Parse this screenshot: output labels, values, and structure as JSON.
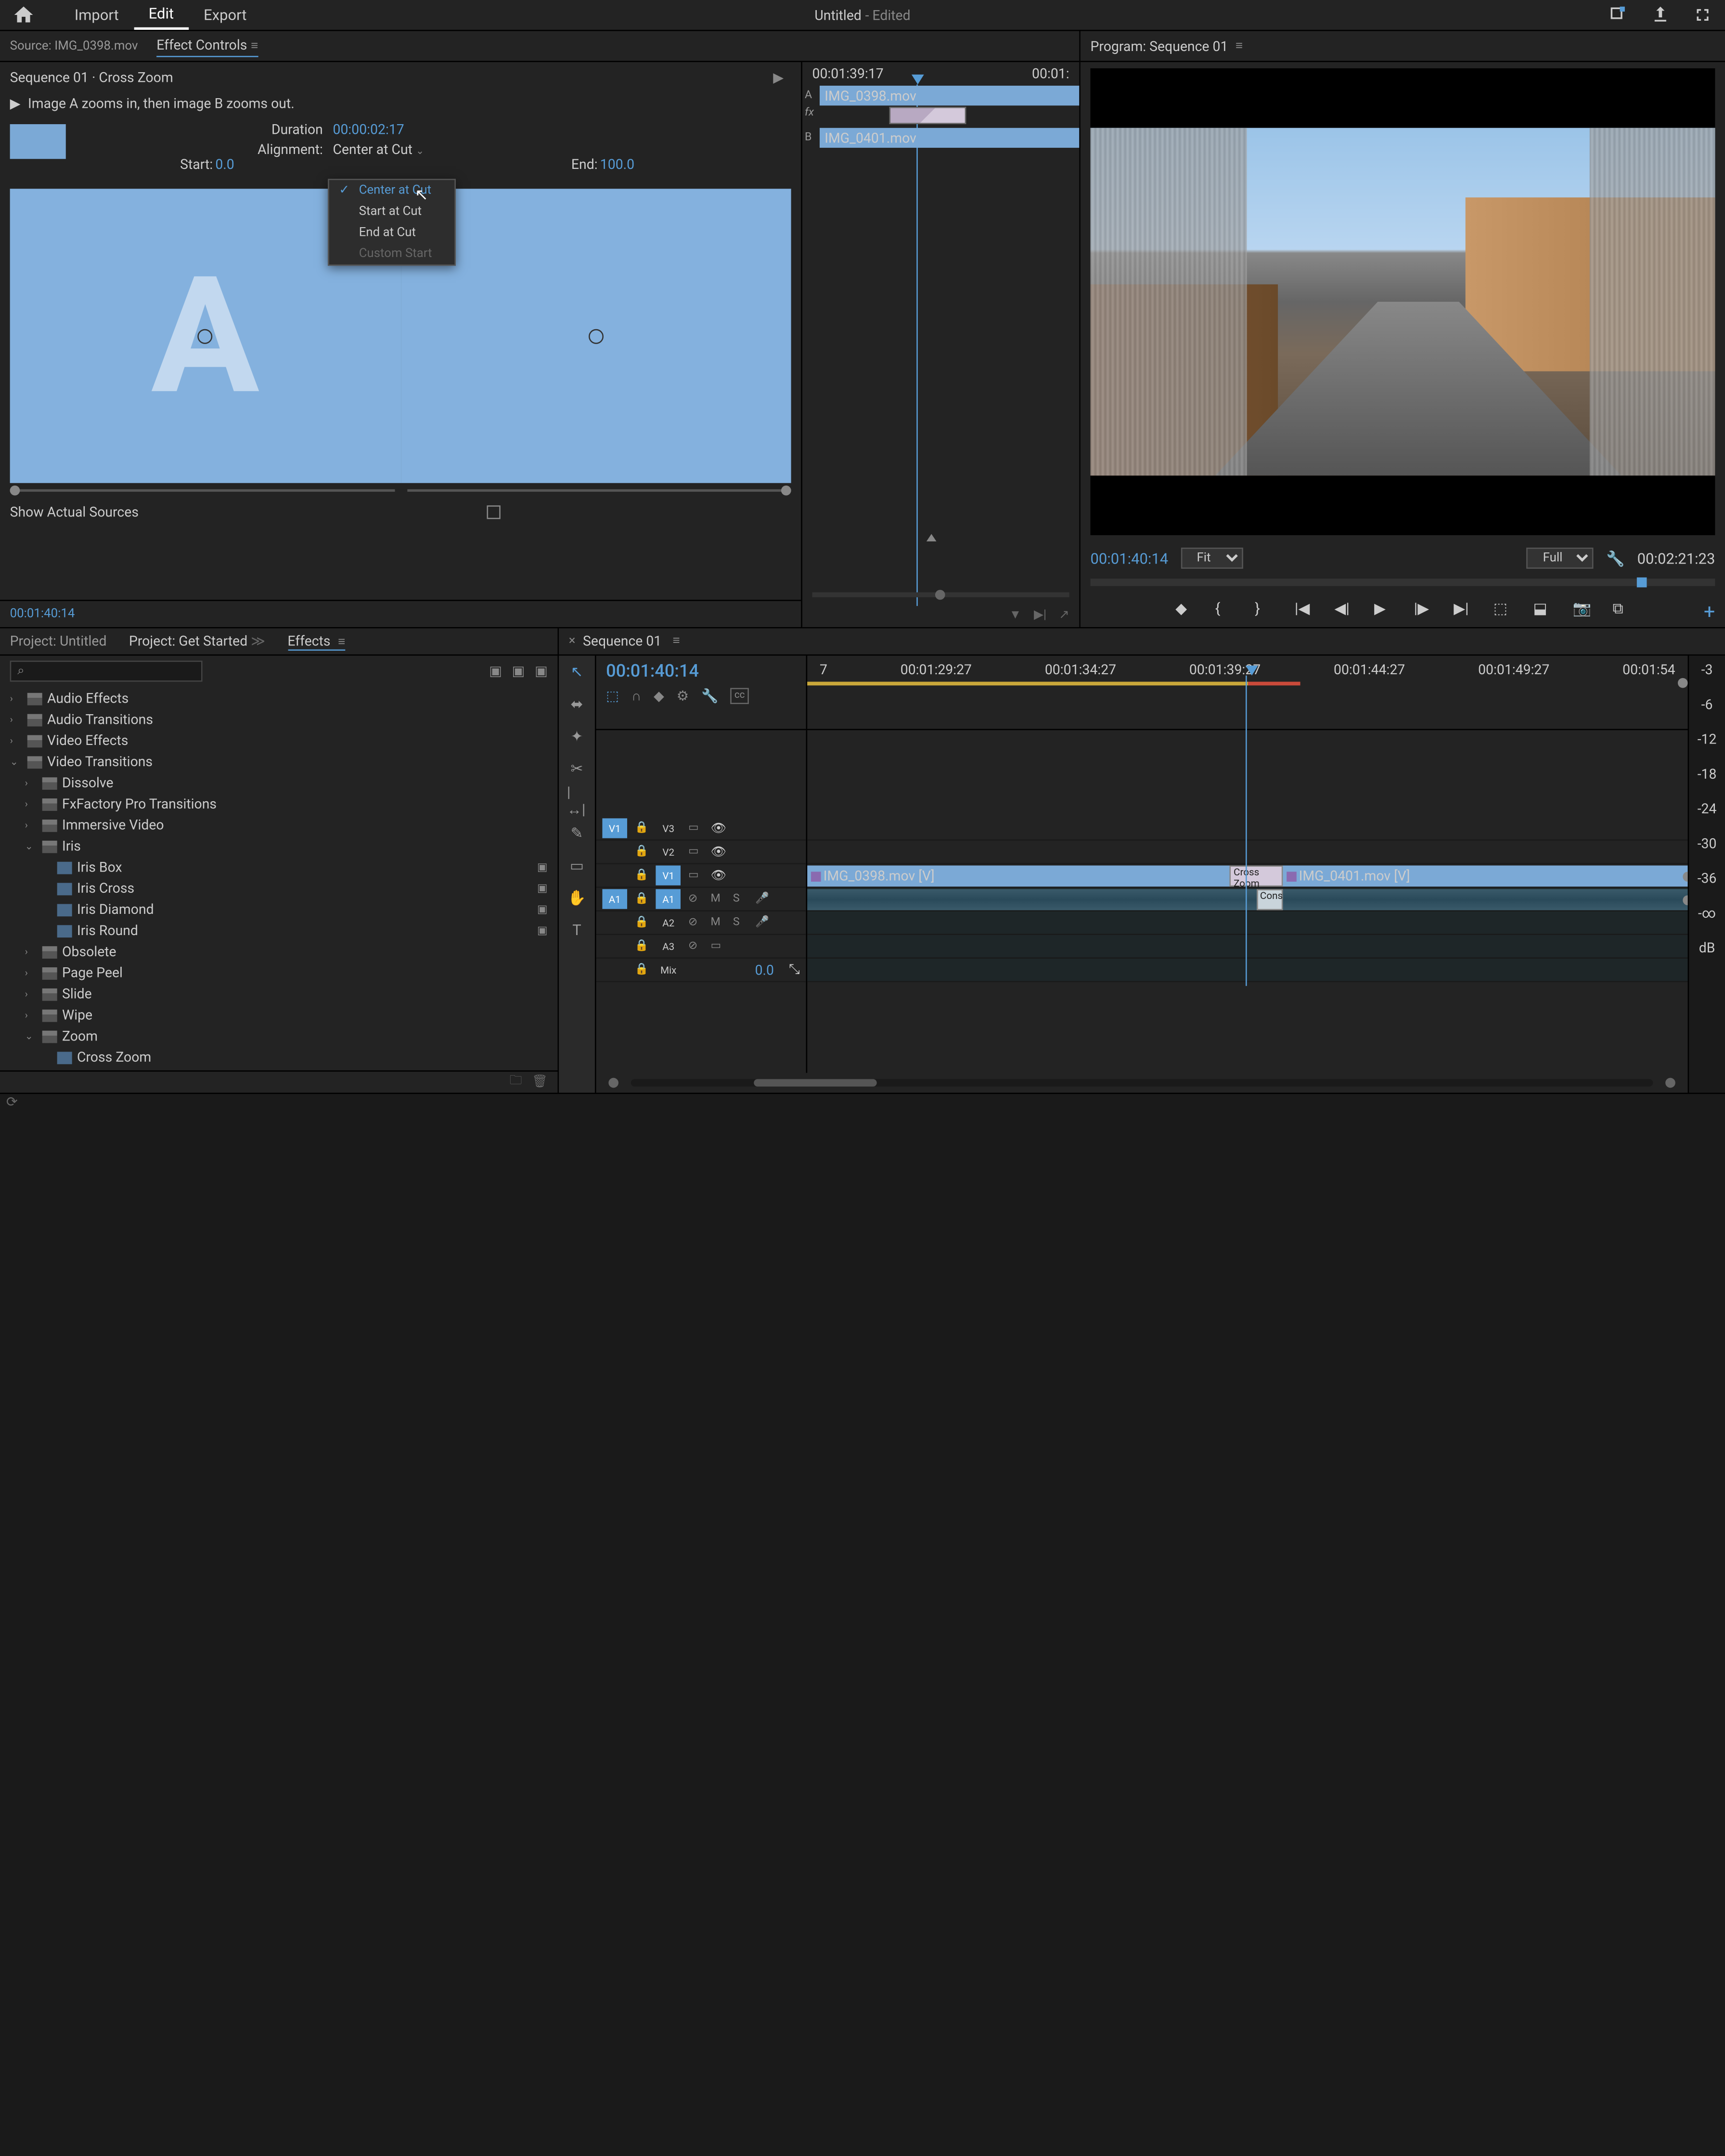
{
  "top": {
    "tabs": [
      "Import",
      "Edit",
      "Export"
    ],
    "active_tab": "Edit",
    "title": "Untitled",
    "title_suffix": "- Edited"
  },
  "source_panel": {
    "tabs": [
      {
        "label": "Source: IMG_0398.mov",
        "active": false
      },
      {
        "label": "Effect Controls",
        "active": true
      }
    ],
    "header": "Sequence 01 · Cross Zoom",
    "description": "Image A zooms in, then image B zooms out.",
    "duration_label": "Duration",
    "duration_value": "00:00:02:17",
    "alignment_label": "Alignment:",
    "alignment_value": "Center at Cut",
    "alignment_options": [
      {
        "label": "Center at Cut",
        "selected": true,
        "disabled": false
      },
      {
        "label": "Start at Cut",
        "selected": false,
        "disabled": false
      },
      {
        "label": "End at Cut",
        "selected": false,
        "disabled": false
      },
      {
        "label": "Custom Start",
        "selected": false,
        "disabled": true
      }
    ],
    "start_label": "Start:",
    "start_value": "0.0",
    "end_label": "End:",
    "end_value": "100.0",
    "show_actual": "Show Actual Sources",
    "timecode": "00:01:40:14",
    "mini_ruler": {
      "left": "00:01:39:17",
      "right": "00:01:"
    },
    "mini_clips": {
      "a": "IMG_0398.mov",
      "b": "IMG_0401.mov",
      "a_label": "A",
      "fx_label": "fx",
      "b_label": "B"
    }
  },
  "program": {
    "title": "Program: Sequence 01",
    "timecode": "00:01:40:14",
    "fit": "Fit",
    "resolution": "Full",
    "duration": "00:02:21:23"
  },
  "project": {
    "tabs": [
      {
        "label": "Project: Untitled",
        "active": false
      },
      {
        "label": "Project: Get Started",
        "active": false
      },
      {
        "label": "Effects",
        "active": true
      }
    ],
    "search_placeholder": "",
    "tree": [
      {
        "label": "Audio Effects",
        "depth": 0,
        "expanded": false,
        "type": "folder"
      },
      {
        "label": "Audio Transitions",
        "depth": 0,
        "expanded": false,
        "type": "folder"
      },
      {
        "label": "Video Effects",
        "depth": 0,
        "expanded": false,
        "type": "folder"
      },
      {
        "label": "Video Transitions",
        "depth": 0,
        "expanded": true,
        "type": "folder"
      },
      {
        "label": "Dissolve",
        "depth": 1,
        "expanded": false,
        "type": "folder"
      },
      {
        "label": "FxFactory Pro Transitions",
        "depth": 1,
        "expanded": false,
        "type": "folder"
      },
      {
        "label": "Immersive Video",
        "depth": 1,
        "expanded": false,
        "type": "folder"
      },
      {
        "label": "Iris",
        "depth": 1,
        "expanded": true,
        "type": "folder"
      },
      {
        "label": "Iris Box",
        "depth": 2,
        "type": "preset",
        "badge": true
      },
      {
        "label": "Iris Cross",
        "depth": 2,
        "type": "preset",
        "badge": true
      },
      {
        "label": "Iris Diamond",
        "depth": 2,
        "type": "preset",
        "badge": true
      },
      {
        "label": "Iris Round",
        "depth": 2,
        "type": "preset",
        "badge": true
      },
      {
        "label": "Obsolete",
        "depth": 1,
        "expanded": false,
        "type": "folder"
      },
      {
        "label": "Page Peel",
        "depth": 1,
        "expanded": false,
        "type": "folder"
      },
      {
        "label": "Slide",
        "depth": 1,
        "expanded": false,
        "type": "folder"
      },
      {
        "label": "Wipe",
        "depth": 1,
        "expanded": false,
        "type": "folder"
      },
      {
        "label": "Zoom",
        "depth": 1,
        "expanded": true,
        "type": "folder"
      },
      {
        "label": "Cross Zoom",
        "depth": 2,
        "type": "preset",
        "badge": false
      }
    ]
  },
  "timeline": {
    "title": "Sequence 01",
    "timecode": "00:01:40:14",
    "ruler": [
      "7",
      "00:01:29:27",
      "00:01:34:27",
      "00:01:39:27",
      "00:01:44:27",
      "00:01:49:27",
      "00:01:54"
    ],
    "video_tracks": [
      {
        "src": "V1",
        "src_on": true,
        "name": "V3",
        "eye": true
      },
      {
        "src": "",
        "name": "V2",
        "eye": true
      },
      {
        "src": "",
        "name": "V1",
        "tgt_on": true,
        "eye": true
      }
    ],
    "audio_tracks": [
      {
        "src": "A1",
        "src_on": true,
        "name": "A1",
        "tgt_on": true
      },
      {
        "src": "",
        "name": "A2"
      },
      {
        "src": "",
        "name": "A3"
      },
      {
        "src": "",
        "name": "Mix",
        "value": "0.0"
      }
    ],
    "clips": {
      "v1_a": "IMG_0398.mov [V]",
      "v1_b": "IMG_0401.mov [V]",
      "transition": "Cross Zoom",
      "audio_trans": "Const"
    },
    "meters": [
      "-3",
      "-6",
      "-12",
      "-18",
      "-24",
      "-30",
      "-36",
      "-∞",
      "dB"
    ]
  }
}
